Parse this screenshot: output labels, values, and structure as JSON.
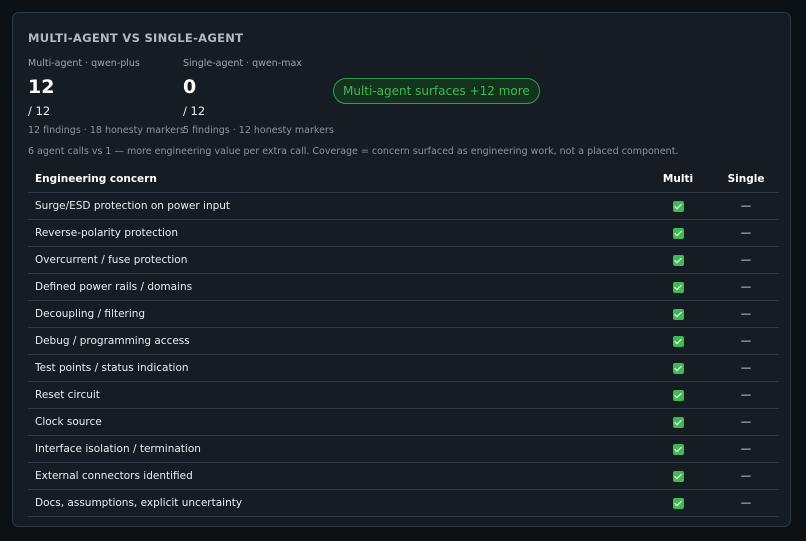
{
  "title": "MULTI-AGENT VS SINGLE-AGENT",
  "multi": {
    "label": "Multi-agent · qwen-plus",
    "value": "12",
    "total": "/ 12",
    "sub": "12 findings · 18 honesty markers"
  },
  "single": {
    "label": "Single-agent · qwen-max",
    "value": "0",
    "total": "/ 12",
    "sub": "5 findings · 12 honesty markers"
  },
  "pill": "Multi-agent surfaces +12 more",
  "accent_color": "#3fb950",
  "note": "6 agent calls vs 1 — more engineering value per extra call. Coverage = concern surfaced as engineering work, not a placed component.",
  "table": {
    "headers": {
      "concern": "Engineering concern",
      "multi": "Multi",
      "single": "Single"
    },
    "rows": [
      {
        "concern": "Surge/ESD protection on power input",
        "multi": "check-icon",
        "single": "—"
      },
      {
        "concern": "Reverse-polarity protection",
        "multi": "check-icon",
        "single": "—"
      },
      {
        "concern": "Overcurrent / fuse protection",
        "multi": "check-icon",
        "single": "—"
      },
      {
        "concern": "Defined power rails / domains",
        "multi": "check-icon",
        "single": "—"
      },
      {
        "concern": "Decoupling / filtering",
        "multi": "check-icon",
        "single": "—"
      },
      {
        "concern": "Debug / programming access",
        "multi": "check-icon",
        "single": "—"
      },
      {
        "concern": "Test points / status indication",
        "multi": "check-icon",
        "single": "—"
      },
      {
        "concern": "Reset circuit",
        "multi": "check-icon",
        "single": "—"
      },
      {
        "concern": "Clock source",
        "multi": "check-icon",
        "single": "—"
      },
      {
        "concern": "Interface isolation / termination",
        "multi": "check-icon",
        "single": "—"
      },
      {
        "concern": "External connectors identified",
        "multi": "check-icon",
        "single": "—"
      },
      {
        "concern": "Docs, assumptions, explicit uncertainty",
        "multi": "check-icon",
        "single": "—"
      }
    ]
  }
}
